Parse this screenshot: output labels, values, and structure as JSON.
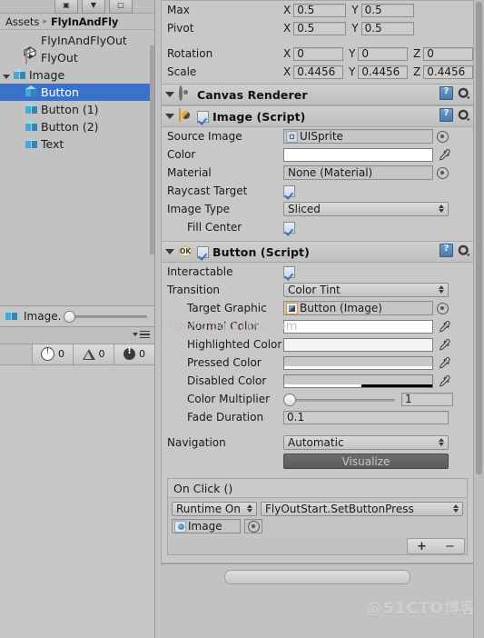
{
  "left_panel": {
    "toolbar_buttons": [
      "create",
      "filter",
      "layout"
    ],
    "breadcrumb": {
      "root": "Assets",
      "separator": "▸",
      "current": "FlyInAndFly"
    },
    "tree": [
      {
        "label": "FlyInAndFlyOut",
        "icon": "unity-prefab-icon",
        "depth": 1,
        "selected": false,
        "expanded": null
      },
      {
        "label": "FlyOut",
        "icon": "script-icon",
        "depth": 1,
        "selected": false,
        "expanded": null
      },
      {
        "label": "Image",
        "icon": "cube-icon",
        "depth": 0,
        "selected": false,
        "expanded": true
      },
      {
        "label": "Button",
        "icon": "cube-icon",
        "depth": 2,
        "selected": true,
        "expanded": null
      },
      {
        "label": "Button (1)",
        "icon": "cube-icon",
        "depth": 2,
        "selected": false,
        "expanded": null
      },
      {
        "label": "Button (2)",
        "icon": "cube-icon",
        "depth": 2,
        "selected": false,
        "expanded": null
      },
      {
        "label": "Text",
        "icon": "cube-icon",
        "depth": 2,
        "selected": false,
        "expanded": null
      }
    ],
    "preview": {
      "label": "Image.",
      "icon": "cube-icon",
      "slider_value": 0
    },
    "console": {
      "info_count": "0",
      "warning_count": "0",
      "error_count": "0"
    }
  },
  "inspector": {
    "rect_transform": {
      "rows": [
        {
          "label": "Max",
          "fields": [
            {
              "axis": "X",
              "value": "0.5"
            },
            {
              "axis": "Y",
              "value": "0.5"
            }
          ]
        },
        {
          "label": "Pivot",
          "fields": [
            {
              "axis": "X",
              "value": "0.5"
            },
            {
              "axis": "Y",
              "value": "0.5"
            }
          ]
        }
      ],
      "rotation": {
        "label": "Rotation",
        "fields": [
          {
            "axis": "X",
            "value": "0"
          },
          {
            "axis": "Y",
            "value": "0"
          },
          {
            "axis": "Z",
            "value": "0"
          }
        ]
      },
      "scale": {
        "label": "Scale",
        "fields": [
          {
            "axis": "X",
            "value": "0.4456"
          },
          {
            "axis": "Y",
            "value": "0.4456"
          },
          {
            "axis": "Z",
            "value": "0.4456"
          }
        ]
      }
    },
    "canvas_renderer": {
      "title": "Canvas Renderer",
      "icon": "canvas-renderer-icon"
    },
    "image_script": {
      "title": "Image (Script)",
      "icon": "image-component-icon",
      "enabled": true,
      "fields": {
        "source_image_label": "Source Image",
        "source_image_value": "UISprite",
        "color_label": "Color",
        "color_value": "#FFFFFF",
        "material_label": "Material",
        "material_value": "None (Material)",
        "raycast_target_label": "Raycast Target",
        "raycast_target_value": true,
        "image_type_label": "Image Type",
        "image_type_value": "Sliced",
        "fill_center_label": "Fill Center",
        "fill_center_value": true
      }
    },
    "button_script": {
      "title": "Button (Script)",
      "icon": "ok-script-icon",
      "enabled": true,
      "fields": {
        "interactable_label": "Interactable",
        "interactable_value": true,
        "transition_label": "Transition",
        "transition_value": "Color Tint",
        "target_graphic_label": "Target Graphic",
        "target_graphic_value": "Button (Image)",
        "normal_color_label": "Normal Color",
        "normal_color_value": "#FFFFFF",
        "highlighted_color_label": "Highlighted Color",
        "highlighted_color_value": "#F5F5F5",
        "pressed_color_label": "Pressed Color",
        "pressed_color_value": "#C8C8C8",
        "disabled_color_label": "Disabled Color",
        "disabled_color_value": "#C8C8C8",
        "disabled_color_alpha": "50%",
        "color_multiplier_label": "Color Multiplier",
        "color_multiplier_value": "1",
        "fade_duration_label": "Fade Duration",
        "fade_duration_value": "0.1",
        "navigation_label": "Navigation",
        "navigation_value": "Automatic",
        "visualize_button": "Visualize"
      },
      "on_click": {
        "title": "On Click ()",
        "runtime_mode": "Runtime On",
        "function": "FlyOutStart.SetButtonPress",
        "object_value": "Image",
        "add_label": "+",
        "remove_label": "−"
      }
    }
  },
  "watermark": "@51CTO博客",
  "ghost_text": "http://blog.51cto.com"
}
